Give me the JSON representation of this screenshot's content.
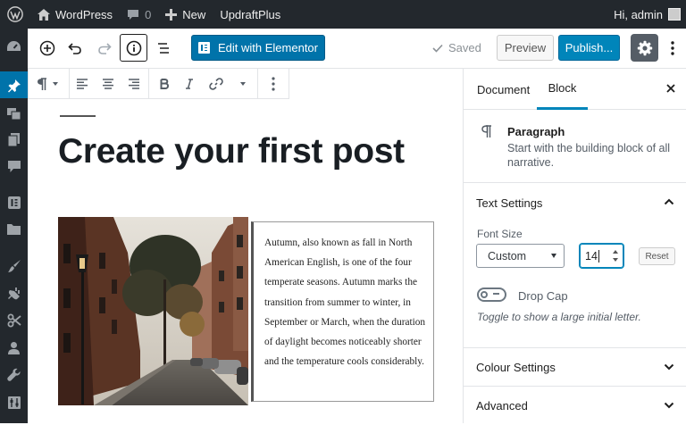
{
  "adminbar": {
    "site_name": "WordPress",
    "comments_count": "0",
    "new_label": "New",
    "plugin_label": "UpdraftPlus",
    "greeting": "Hi, admin"
  },
  "header": {
    "elementor_label": "Edit with Elementor",
    "saved_label": "Saved",
    "preview_label": "Preview",
    "publish_label": "Publish..."
  },
  "post": {
    "title": "Create your first post",
    "paragraph": "Autumn, also known as fall in North American English, is one of the four temperate seasons. Autumn marks the transition from summer to winter, in September or March, when the duration of daylight becomes noticeably shorter and the temperature cools considerably."
  },
  "sidebar": {
    "tabs": [
      {
        "label": "Document"
      },
      {
        "label": "Block"
      }
    ],
    "block": {
      "name": "Paragraph",
      "description": "Start with the building block of all narrative."
    },
    "text_settings": {
      "title": "Text Settings",
      "font_size_label": "Font Size",
      "font_size_option": "Custom",
      "font_size_value": "14",
      "reset_label": "Reset",
      "drop_cap_label": "Drop Cap",
      "drop_cap_help": "Toggle to show a large initial letter."
    },
    "colour_settings": {
      "title": "Colour Settings"
    },
    "advanced": {
      "title": "Advanced"
    }
  },
  "colors": {
    "admin_bg": "#23282d",
    "accent": "#0085ba",
    "elementor_bg": "#0073aa"
  }
}
